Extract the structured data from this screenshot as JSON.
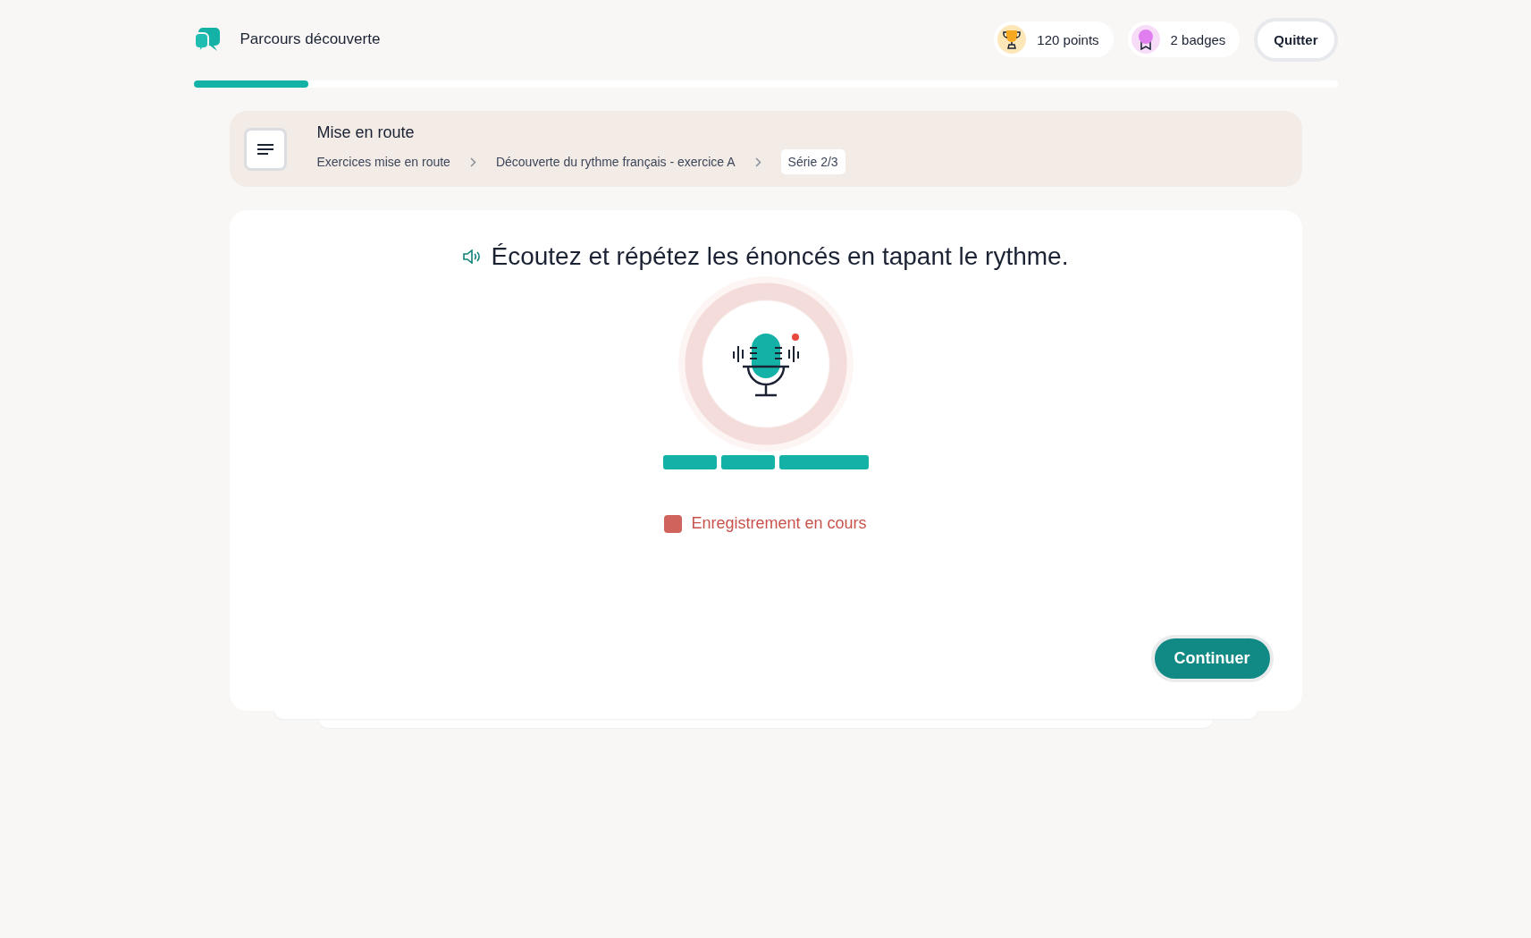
{
  "header": {
    "title": "Parcours découverte",
    "points": "120 points",
    "badges": "2 badges",
    "quit_button": "Quitter"
  },
  "progress": {
    "level": 0.1
  },
  "breadcrumb": {
    "title": "Mise en route",
    "items": [
      {
        "label": "Exercices mise en route",
        "kind": "link"
      },
      {
        "label": "Découverte du rythme français - exercice A",
        "kind": "link"
      },
      {
        "label": "Série 2/3",
        "kind": "current"
      }
    ]
  },
  "exercise": {
    "instruction": "Écoutez et répétez les énoncés en tapant le rythme.",
    "recording": true,
    "rhythm": [
      {
        "kind": "short"
      },
      {
        "kind": "short"
      },
      {
        "kind": "long"
      }
    ],
    "status": "Enregistrement en cours",
    "continue_button": "Continuer"
  }
}
